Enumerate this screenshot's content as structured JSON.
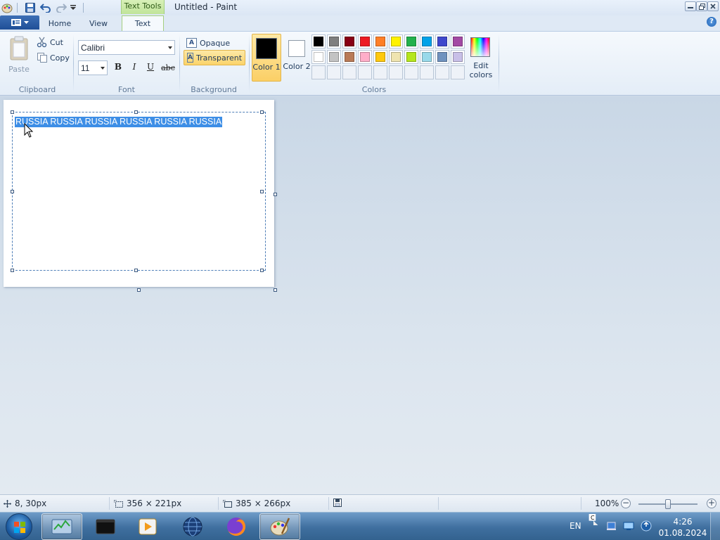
{
  "window": {
    "title": "Untitled - Paint",
    "contextual_group": "Text Tools"
  },
  "tabs": {
    "home": "Home",
    "view": "View",
    "text": "Text",
    "active": "Text"
  },
  "clipboard": {
    "paste_label": "Paste",
    "cut_label": "Cut",
    "copy_label": "Copy",
    "group_label": "Clipboard"
  },
  "font": {
    "family": "Calibri",
    "size": "11",
    "bold_label": "B",
    "italic_label": "I",
    "underline_label": "U",
    "strikethrough_label": "abc",
    "group_label": "Font"
  },
  "background": {
    "opaque_label": "Opaque",
    "transparent_label": "Transparent",
    "selected": "Transparent",
    "group_label": "Background"
  },
  "colors": {
    "color1_label": "Color 1",
    "color1_value": "#000000",
    "color2_label": "Color 2",
    "color2_value": "#ffffff",
    "palette": [
      "#000000",
      "#7f7f7f",
      "#880015",
      "#ed1c24",
      "#ff7f27",
      "#fff200",
      "#22b14c",
      "#00a2e8",
      "#3f48cc",
      "#a349a4",
      "#ffffff",
      "#c3c3c3",
      "#b97a57",
      "#ffaec9",
      "#ffc90e",
      "#efe4b0",
      "#b5e61d",
      "#99d9ea",
      "#7092be",
      "#c8bfe7"
    ],
    "custom_slots": 10,
    "edit_colors_label": "Edit colors",
    "group_label": "Colors"
  },
  "canvas": {
    "text_content": "RUSSIA RUSSIA RUSSIA RUSSIA RUSSIA RUSSIA",
    "selection_color": "#3d8ee6"
  },
  "statusbar": {
    "cursor_position": "8, 30px",
    "selection_size": "356 × 221px",
    "image_size": "385 × 266px",
    "zoom": "100%",
    "zoom_level": 1.0
  },
  "taskbar": {
    "apps": [
      "task-manager",
      "terminal",
      "media-player",
      "browser-globe",
      "firefox",
      "paint"
    ],
    "active_app": "paint",
    "language": "EN",
    "time": "4:26",
    "date": "01.08.2024"
  }
}
